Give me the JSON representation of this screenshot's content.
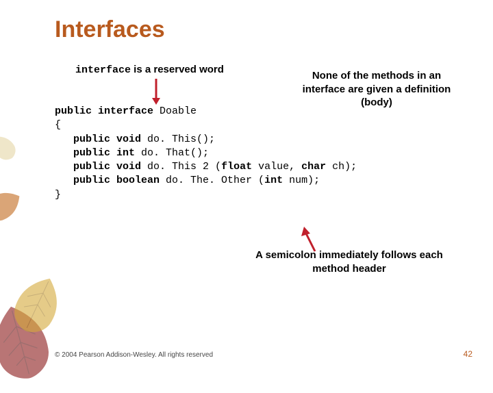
{
  "title": "Interfaces",
  "callout1_prefix": "interface",
  "callout1_rest": " is a reserved word",
  "callout2": "None of the methods in an interface are given a definition (body)",
  "code": {
    "l1a": "public interface",
    "l1b": " Doable",
    "l2": "{",
    "l3a": "   public void",
    "l3b": " do. This();",
    "l4a": "   public int",
    "l4b": " do. That();",
    "l5a": "   public void",
    "l5b": " do. This 2 (",
    "l5c": "float",
    "l5d": " value, ",
    "l5e": "char",
    "l5f": " ch);",
    "l6a": "   public boolean",
    "l6b": " do. The. Other (",
    "l6c": "int",
    "l6d": " num);",
    "l7": "}"
  },
  "callout3": "A semicolon immediately follows each method header",
  "footer": "© 2004 Pearson Addison-Wesley. All rights reserved",
  "page": "42",
  "colors": {
    "accent": "#b85a1e",
    "arrow": "#c0202c"
  }
}
